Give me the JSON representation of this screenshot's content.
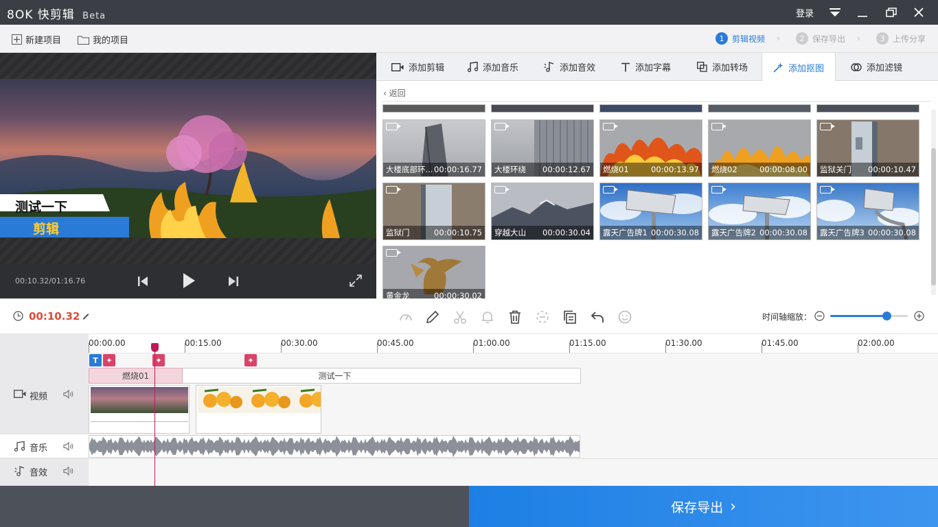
{
  "app": {
    "name": "快剪辑",
    "logo_prefix": "8OK",
    "badge": "Beta"
  },
  "titlebar": {
    "login": "登录"
  },
  "projects": {
    "new_label": "新建项目",
    "mine_label": "我的项目"
  },
  "steps": [
    {
      "num": "1",
      "label": "剪辑视频"
    },
    {
      "num": "2",
      "label": "保存导出"
    },
    {
      "num": "3",
      "label": "上传分享"
    }
  ],
  "preview": {
    "overlay_title": "测试一下",
    "overlay_sub": "剪辑",
    "time": "00:10.32/01:16.76"
  },
  "tabs": [
    "添加剪辑",
    "添加音乐",
    "添加音效",
    "添加字幕",
    "添加转场",
    "添加抠图",
    "添加滤镜"
  ],
  "library": {
    "back_label": "返回",
    "items": [
      {
        "name": "大楼底部环...",
        "duration": "00:00:16.77"
      },
      {
        "name": "大楼环绕",
        "duration": "00:00:12.67"
      },
      {
        "name": "燃烧01",
        "duration": "00:00:13.97"
      },
      {
        "name": "燃烧02",
        "duration": "00:00:08.00"
      },
      {
        "name": "监狱关门",
        "duration": "00:00:10.47"
      },
      {
        "name": "监狱门",
        "duration": "00:00:10.75"
      },
      {
        "name": "穿越大山",
        "duration": "00:00:30.04"
      },
      {
        "name": "露天广告牌1",
        "duration": "00:00:30.08"
      },
      {
        "name": "露天广告牌2",
        "duration": "00:00:30.08"
      },
      {
        "name": "露天广告牌3",
        "duration": "00:00:30.08"
      },
      {
        "name": "黄金龙",
        "duration": "00:00:30.02"
      }
    ]
  },
  "toolbar": {
    "current_time": "00:10.32",
    "zoom_label": "时间轴缩放：",
    "zoom_level": 0.73
  },
  "ruler": [
    "00:00.00",
    "00:15.00",
    "00:30.00",
    "00:45.00",
    "01:00.00",
    "01:15.00",
    "01:30.00",
    "01:45.00",
    "02:00.00"
  ],
  "tracks": {
    "video": "视频",
    "music": "音乐",
    "sfx": "音效"
  },
  "clips": {
    "effect_clip": "燃烧01",
    "text_clip": "测试一下"
  },
  "footer": {
    "export_label": "保存导出"
  }
}
